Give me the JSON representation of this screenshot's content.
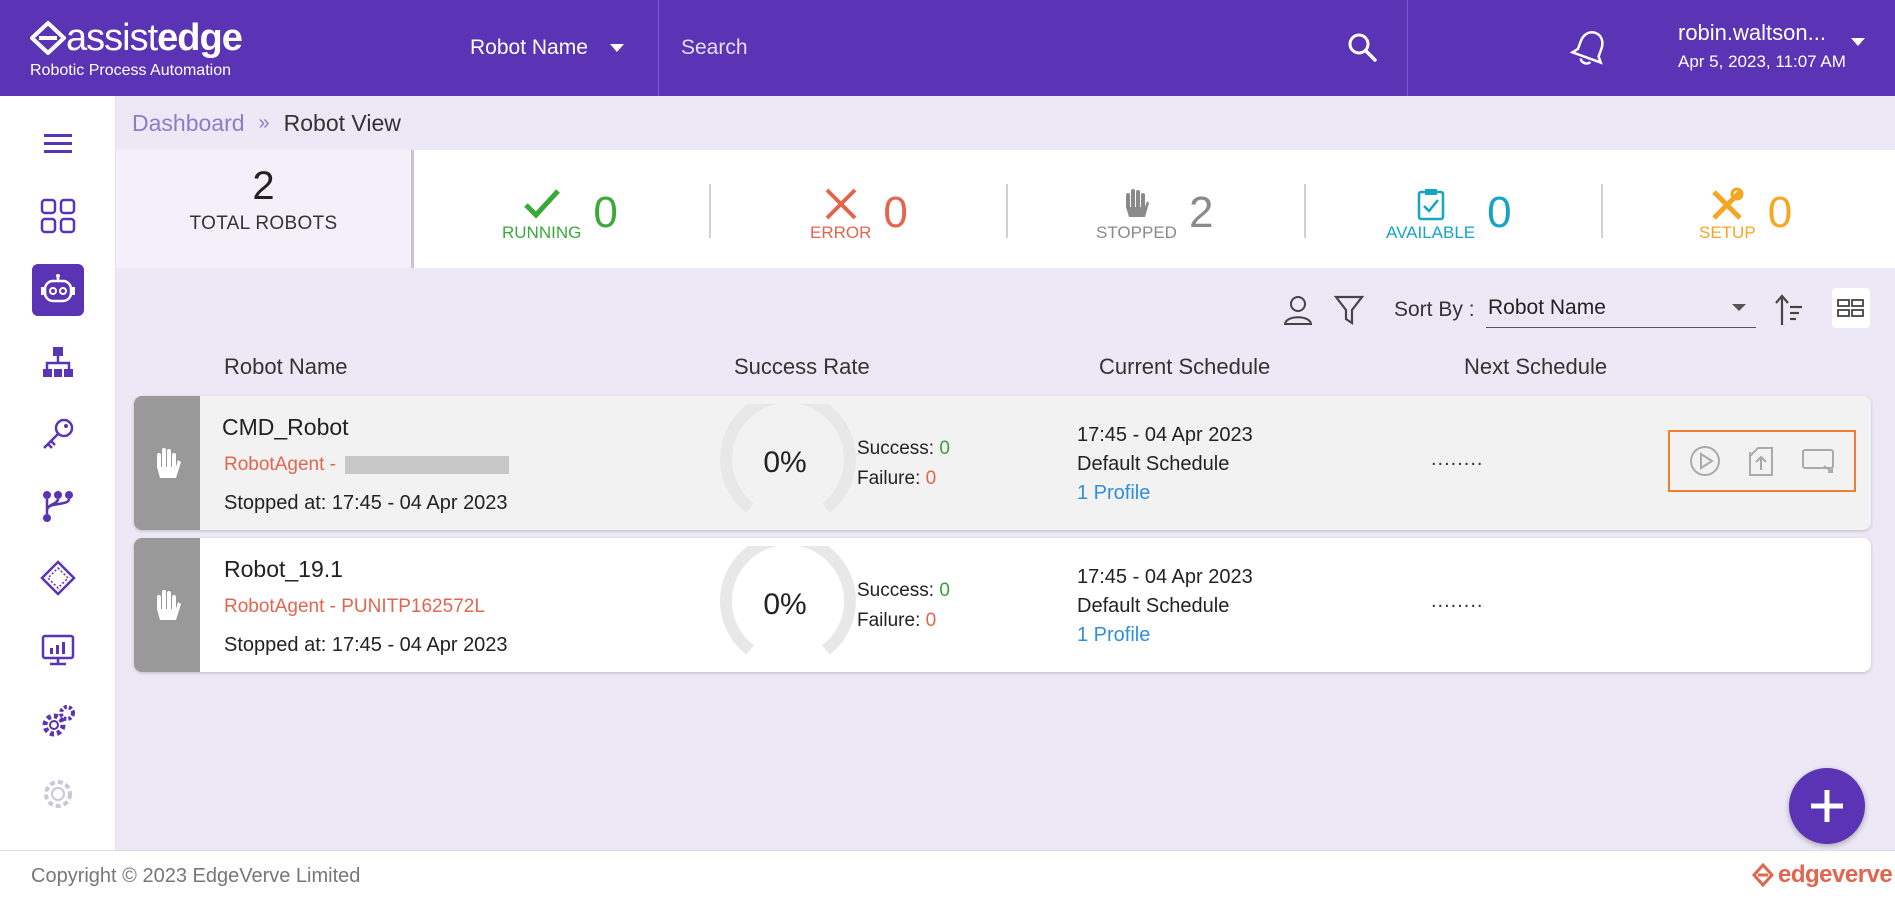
{
  "header": {
    "brand_light": "assist",
    "brand_bold": "edge",
    "tagline": "Robotic Process Automation",
    "robot_select_label": "Robot Name",
    "search_placeholder": "Search",
    "user_name": "robin.waltson...",
    "user_datetime": "Apr 5, 2023, 11:07 AM"
  },
  "breadcrumb": {
    "parent": "Dashboard",
    "current": "Robot View"
  },
  "summary": {
    "total_count": "2",
    "total_label": "TOTAL ROBOTS",
    "running": {
      "label": "RUNNING",
      "count": "0",
      "color": "#3aa93a"
    },
    "error": {
      "label": "ERROR",
      "count": "0",
      "color": "#e2654e"
    },
    "stopped": {
      "label": "STOPPED",
      "count": "2",
      "color": "#8a8a8a"
    },
    "available": {
      "label": "AVAILABLE",
      "count": "0",
      "color": "#16a3c8"
    },
    "setup": {
      "label": "SETUP",
      "count": "0",
      "color": "#f5a623"
    }
  },
  "toolbar": {
    "sort_label": "Sort By :",
    "sort_value": "Robot Name"
  },
  "columns": {
    "robot_name": "Robot Name",
    "success_rate": "Success Rate",
    "current_schedule": "Current Schedule",
    "next_schedule": "Next Schedule"
  },
  "robots": [
    {
      "name": "CMD_Robot",
      "agent_prefix": "RobotAgent - ",
      "stopped_at": "Stopped at: 17:45 - 04 Apr 2023",
      "rate": "0%",
      "success_label": "Success: ",
      "success_value": "0",
      "failure_label": "Failure: ",
      "failure_value": "0",
      "schedule_time": "17:45 - 04 Apr 2023",
      "schedule_name": "Default Schedule",
      "profile_link": "1 Profile",
      "next_schedule": "........"
    },
    {
      "name": "Robot_19.1",
      "agent_prefix": "RobotAgent - ",
      "agent_name": "PUNITP162572L",
      "stopped_at": "Stopped at: 17:45 - 04 Apr 2023",
      "rate": "0%",
      "success_label": "Success: ",
      "success_value": "0",
      "failure_label": "Failure: ",
      "failure_value": "0",
      "schedule_time": "17:45 - 04 Apr 2023",
      "schedule_name": "Default Schedule",
      "profile_link": "1 Profile",
      "next_schedule": "........"
    }
  ],
  "sidebar_icons": [
    "menu-icon",
    "dashboard-grid-icon",
    "robot-icon",
    "hierarchy-icon",
    "key-icon",
    "workflow-icon",
    "chip-icon",
    "monitor-chart-icon",
    "settings-gears-icon",
    "settings-disabled-icon"
  ],
  "footer": {
    "copyright": "Copyright © 2023 EdgeVerve Limited",
    "logo_text": "edgeverve"
  },
  "colors": {
    "primary": "#5b33b5",
    "content_bg": "#ede8f6",
    "action_highlight": "#f07d30"
  }
}
